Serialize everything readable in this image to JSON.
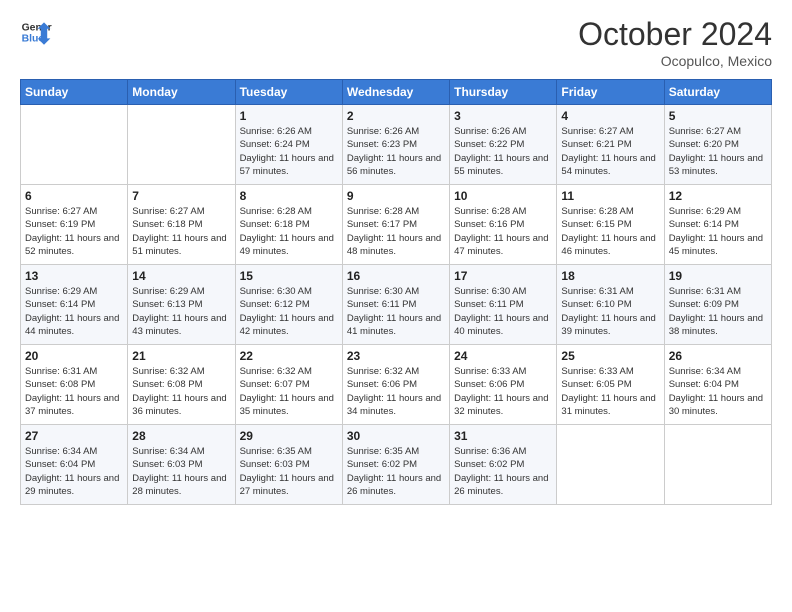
{
  "logo": {
    "text_general": "General",
    "text_blue": "Blue"
  },
  "header": {
    "month": "October 2024",
    "location": "Ocopulco, Mexico"
  },
  "weekdays": [
    "Sunday",
    "Monday",
    "Tuesday",
    "Wednesday",
    "Thursday",
    "Friday",
    "Saturday"
  ],
  "weeks": [
    [
      {
        "day": "",
        "info": ""
      },
      {
        "day": "",
        "info": ""
      },
      {
        "day": "1",
        "info": "Sunrise: 6:26 AM\nSunset: 6:24 PM\nDaylight: 11 hours and 57 minutes."
      },
      {
        "day": "2",
        "info": "Sunrise: 6:26 AM\nSunset: 6:23 PM\nDaylight: 11 hours and 56 minutes."
      },
      {
        "day": "3",
        "info": "Sunrise: 6:26 AM\nSunset: 6:22 PM\nDaylight: 11 hours and 55 minutes."
      },
      {
        "day": "4",
        "info": "Sunrise: 6:27 AM\nSunset: 6:21 PM\nDaylight: 11 hours and 54 minutes."
      },
      {
        "day": "5",
        "info": "Sunrise: 6:27 AM\nSunset: 6:20 PM\nDaylight: 11 hours and 53 minutes."
      }
    ],
    [
      {
        "day": "6",
        "info": "Sunrise: 6:27 AM\nSunset: 6:19 PM\nDaylight: 11 hours and 52 minutes."
      },
      {
        "day": "7",
        "info": "Sunrise: 6:27 AM\nSunset: 6:18 PM\nDaylight: 11 hours and 51 minutes."
      },
      {
        "day": "8",
        "info": "Sunrise: 6:28 AM\nSunset: 6:18 PM\nDaylight: 11 hours and 49 minutes."
      },
      {
        "day": "9",
        "info": "Sunrise: 6:28 AM\nSunset: 6:17 PM\nDaylight: 11 hours and 48 minutes."
      },
      {
        "day": "10",
        "info": "Sunrise: 6:28 AM\nSunset: 6:16 PM\nDaylight: 11 hours and 47 minutes."
      },
      {
        "day": "11",
        "info": "Sunrise: 6:28 AM\nSunset: 6:15 PM\nDaylight: 11 hours and 46 minutes."
      },
      {
        "day": "12",
        "info": "Sunrise: 6:29 AM\nSunset: 6:14 PM\nDaylight: 11 hours and 45 minutes."
      }
    ],
    [
      {
        "day": "13",
        "info": "Sunrise: 6:29 AM\nSunset: 6:14 PM\nDaylight: 11 hours and 44 minutes."
      },
      {
        "day": "14",
        "info": "Sunrise: 6:29 AM\nSunset: 6:13 PM\nDaylight: 11 hours and 43 minutes."
      },
      {
        "day": "15",
        "info": "Sunrise: 6:30 AM\nSunset: 6:12 PM\nDaylight: 11 hours and 42 minutes."
      },
      {
        "day": "16",
        "info": "Sunrise: 6:30 AM\nSunset: 6:11 PM\nDaylight: 11 hours and 41 minutes."
      },
      {
        "day": "17",
        "info": "Sunrise: 6:30 AM\nSunset: 6:11 PM\nDaylight: 11 hours and 40 minutes."
      },
      {
        "day": "18",
        "info": "Sunrise: 6:31 AM\nSunset: 6:10 PM\nDaylight: 11 hours and 39 minutes."
      },
      {
        "day": "19",
        "info": "Sunrise: 6:31 AM\nSunset: 6:09 PM\nDaylight: 11 hours and 38 minutes."
      }
    ],
    [
      {
        "day": "20",
        "info": "Sunrise: 6:31 AM\nSunset: 6:08 PM\nDaylight: 11 hours and 37 minutes."
      },
      {
        "day": "21",
        "info": "Sunrise: 6:32 AM\nSunset: 6:08 PM\nDaylight: 11 hours and 36 minutes."
      },
      {
        "day": "22",
        "info": "Sunrise: 6:32 AM\nSunset: 6:07 PM\nDaylight: 11 hours and 35 minutes."
      },
      {
        "day": "23",
        "info": "Sunrise: 6:32 AM\nSunset: 6:06 PM\nDaylight: 11 hours and 34 minutes."
      },
      {
        "day": "24",
        "info": "Sunrise: 6:33 AM\nSunset: 6:06 PM\nDaylight: 11 hours and 32 minutes."
      },
      {
        "day": "25",
        "info": "Sunrise: 6:33 AM\nSunset: 6:05 PM\nDaylight: 11 hours and 31 minutes."
      },
      {
        "day": "26",
        "info": "Sunrise: 6:34 AM\nSunset: 6:04 PM\nDaylight: 11 hours and 30 minutes."
      }
    ],
    [
      {
        "day": "27",
        "info": "Sunrise: 6:34 AM\nSunset: 6:04 PM\nDaylight: 11 hours and 29 minutes."
      },
      {
        "day": "28",
        "info": "Sunrise: 6:34 AM\nSunset: 6:03 PM\nDaylight: 11 hours and 28 minutes."
      },
      {
        "day": "29",
        "info": "Sunrise: 6:35 AM\nSunset: 6:03 PM\nDaylight: 11 hours and 27 minutes."
      },
      {
        "day": "30",
        "info": "Sunrise: 6:35 AM\nSunset: 6:02 PM\nDaylight: 11 hours and 26 minutes."
      },
      {
        "day": "31",
        "info": "Sunrise: 6:36 AM\nSunset: 6:02 PM\nDaylight: 11 hours and 26 minutes."
      },
      {
        "day": "",
        "info": ""
      },
      {
        "day": "",
        "info": ""
      }
    ]
  ]
}
